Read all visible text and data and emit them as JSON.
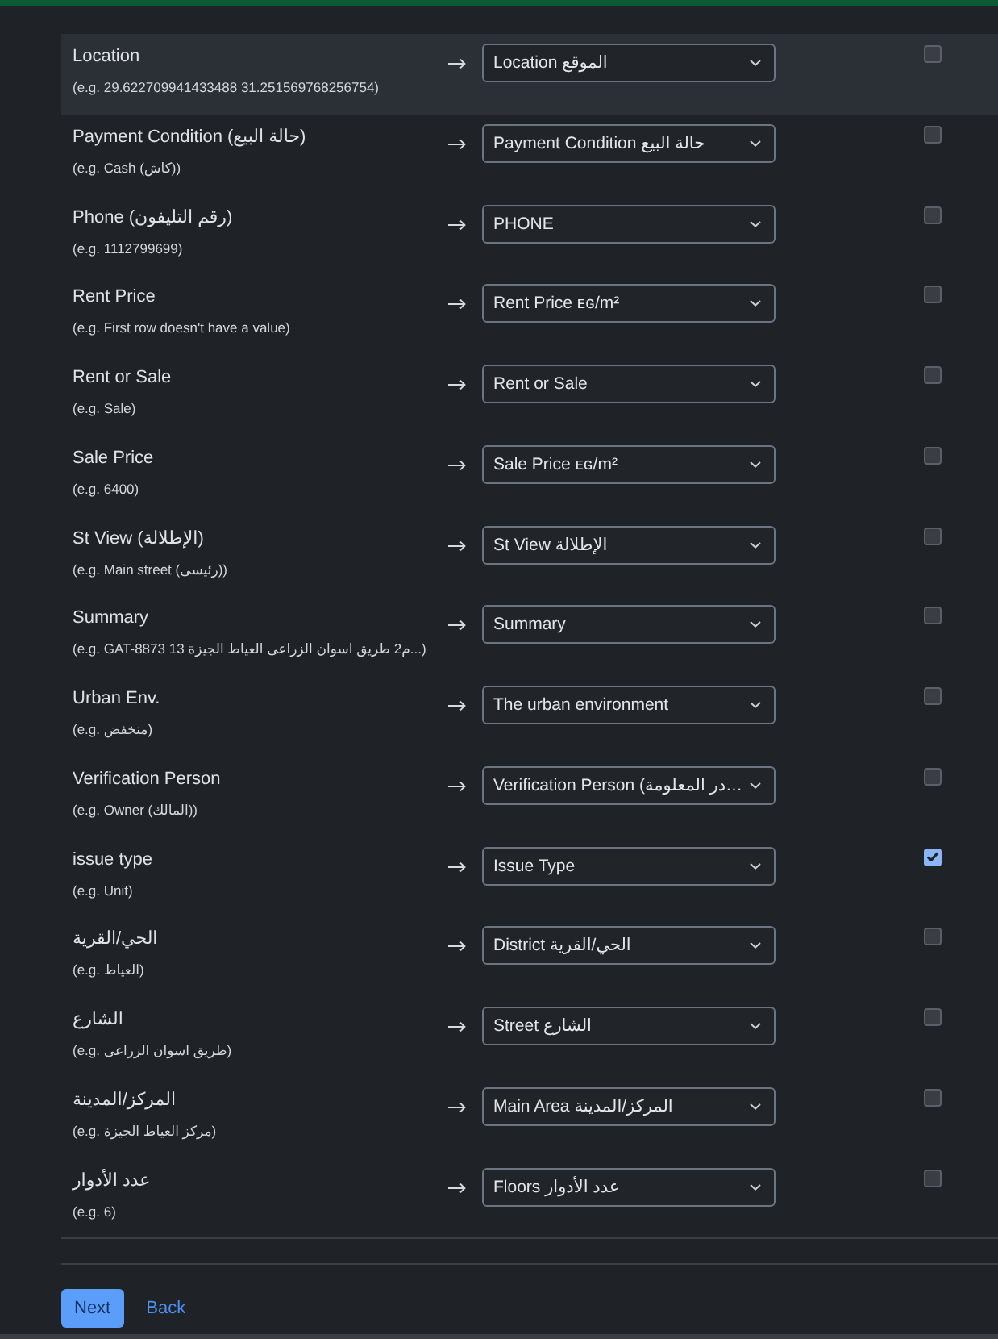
{
  "rows": [
    {
      "label": "Location",
      "example": "(e.g. 29.622709941433488 31.251569768256754)",
      "mapped_to": "Location الموقع",
      "checked": false,
      "highlighted": true
    },
    {
      "label": "Payment Condition (حالة البيع)",
      "example": "(e.g. Cash (كاش))",
      "mapped_to": "Payment Condition حالة البيع",
      "checked": false,
      "highlighted": false
    },
    {
      "label": "Phone (رقم التليفون)",
      "example": "(e.g. 1112799699)",
      "mapped_to": "PHONE",
      "checked": false,
      "highlighted": false
    },
    {
      "label": "Rent Price",
      "example": "(e.g. First row doesn't have a value)",
      "mapped_to": "Rent Price ᴇɢ/m²",
      "checked": false,
      "highlighted": false
    },
    {
      "label": "Rent or Sale",
      "example": "(e.g. Sale)",
      "mapped_to": "Rent or Sale",
      "checked": false,
      "highlighted": false
    },
    {
      "label": "Sale Price",
      "example": "(e.g. 6400)",
      "mapped_to": "Sale Price ᴇɢ/m²",
      "checked": false,
      "highlighted": false
    },
    {
      "label": "St View (الإطلالة)",
      "example": "(e.g. Main street (رئيسى))",
      "mapped_to": "St View الإطلالة",
      "checked": false,
      "highlighted": false
    },
    {
      "label": "Summary",
      "example": "(e.g. GAT-8873 13 م2 طريق اسوان الزراعى العياط الجيزة...)",
      "mapped_to": "Summary",
      "checked": false,
      "highlighted": false
    },
    {
      "label": "Urban Env.",
      "example": "(e.g. منخفض)",
      "mapped_to": "The urban environment",
      "checked": false,
      "highlighted": false
    },
    {
      "label": "Verification Person",
      "example": "(e.g. Owner (المالك))",
      "mapped_to": "Verification Person (در المعلومة…",
      "checked": false,
      "highlighted": false
    },
    {
      "label": "issue type",
      "example": "(e.g. Unit)",
      "mapped_to": "Issue Type",
      "checked": true,
      "highlighted": false
    },
    {
      "label": "الحي/القرية",
      "example": "(e.g. العياط)",
      "mapped_to": "District الحي/القرية",
      "checked": false,
      "highlighted": false
    },
    {
      "label": "الشارع",
      "example": "(e.g. طريق اسوان الزراعى)",
      "mapped_to": "Street الشارع",
      "checked": false,
      "highlighted": false
    },
    {
      "label": "المركز/المدينة",
      "example": "(e.g. مركز العياط الجيزة)",
      "mapped_to": "Main Area المركز/المدينة",
      "checked": false,
      "highlighted": false
    },
    {
      "label": "عدد الأدوار",
      "example": "(e.g. 6)",
      "mapped_to": "Floors عدد الأدوار",
      "checked": false,
      "highlighted": false
    }
  ],
  "next_button": {
    "label": "Next"
  },
  "back_link": {
    "label": "Back"
  }
}
